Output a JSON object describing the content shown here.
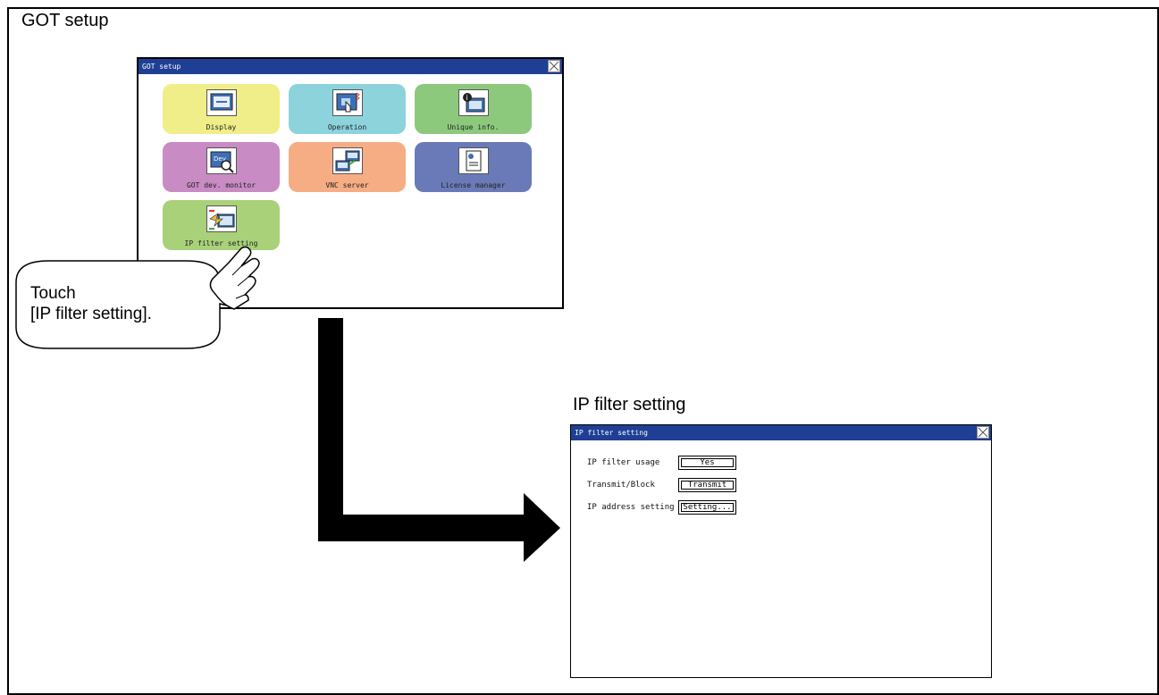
{
  "got_setup": {
    "heading": "GOT setup",
    "window_title": "GOT setup",
    "tiles": [
      {
        "label": "Display",
        "color": "#f0ee88",
        "icon": "display-icon"
      },
      {
        "label": "Operation",
        "color": "#8dd3dc",
        "icon": "operation-icon"
      },
      {
        "label": "Unique info.",
        "color": "#8dc97d",
        "icon": "unique-info-icon"
      },
      {
        "label": "GOT dev. monitor",
        "color": "#c88bc3",
        "icon": "dev-monitor-icon"
      },
      {
        "label": "VNC server",
        "color": "#f7ad83",
        "icon": "vnc-server-icon"
      },
      {
        "label": "License manager",
        "color": "#6a7ab8",
        "icon": "license-icon"
      },
      {
        "label": "IP filter setting",
        "color": "#a8d179",
        "icon": "ip-filter-icon"
      }
    ]
  },
  "callout": {
    "line1": "Touch",
    "line2": "[IP filter setting]."
  },
  "ip_filter": {
    "heading": "IP filter setting",
    "window_title": "IP filter setting",
    "rows": [
      {
        "label": "IP filter usage",
        "value": "Yes"
      },
      {
        "label": "Transmit/Block",
        "value": "Transmit"
      },
      {
        "label": "IP address setting",
        "value": "Setting..."
      }
    ]
  },
  "colors": {
    "titlebar": "#1f3f95",
    "arrow": "#000000"
  }
}
